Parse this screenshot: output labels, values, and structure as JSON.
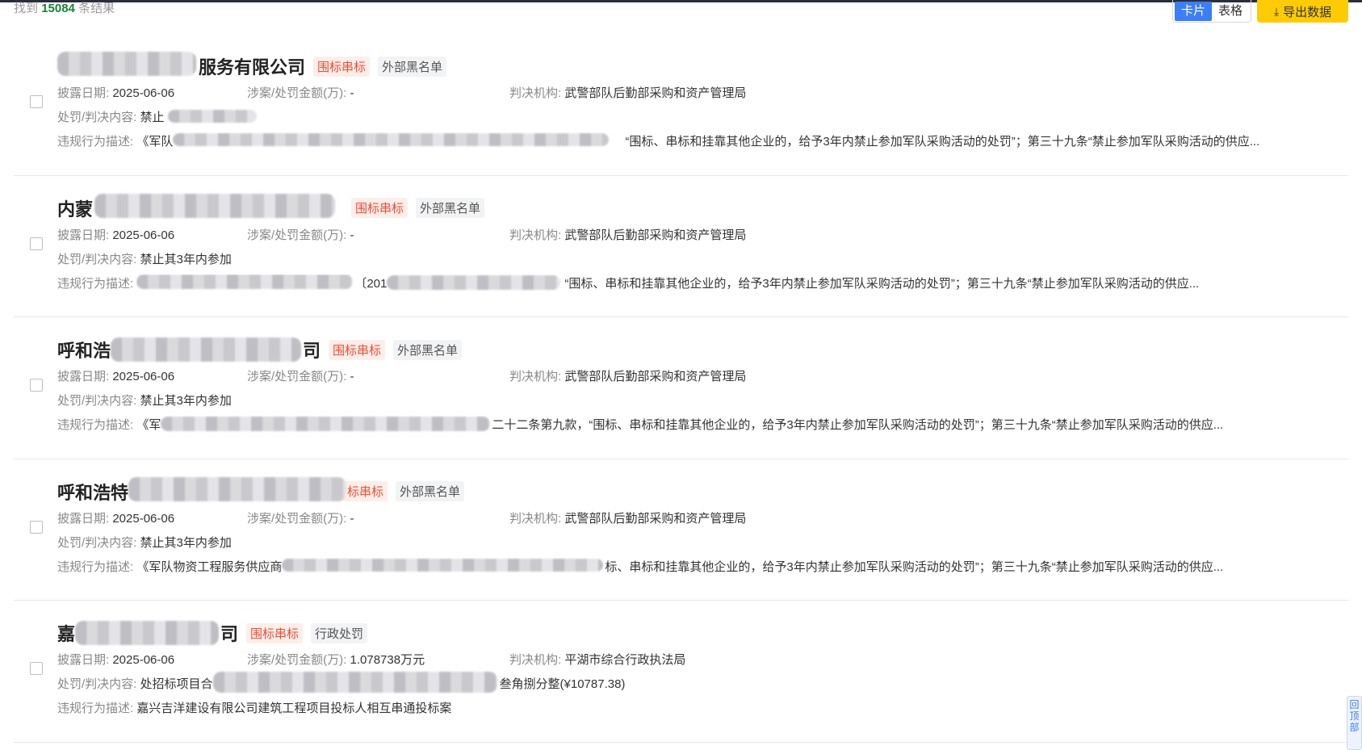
{
  "header": {
    "summary_prefix": "找到",
    "result_count": "15084",
    "summary_suffix": "条结果",
    "view_card": "卡片",
    "view_table": "表格",
    "export_label": "导出数据",
    "export_icon": "download-icon"
  },
  "labels": {
    "date": "披露日期:",
    "amount": "涉案/处罚金额(万):",
    "authority": "判决机构:",
    "penalty": "处罚/判决内容:",
    "violation": "违规行为描述:"
  },
  "records": [
    {
      "title": "服务有限公司",
      "tag1": "围标串标",
      "tag2": "外部黑名单",
      "date": "2025-06-06",
      "amount": "-",
      "authority": "武警部队后勤部采购和资产管理局",
      "penalty": "禁止",
      "violation": "《军队",
      "violation_tail": "“围标、串标和挂靠其他企业的，给予3年内禁止参加军队采购活动的处罚”；第三十九条“禁止参加军队采购活动的供应..."
    },
    {
      "title": "内蒙",
      "tag1": "围标串标",
      "tag2": "外部黑名单",
      "date": "2025-06-06",
      "amount": "-",
      "authority": "武警部队后勤部采购和资产管理局",
      "penalty": "禁止其3年内参加",
      "violation": "〔201",
      "violation_tail": "“围标、串标和挂靠其他企业的，给予3年内禁止参加军队采购活动的处罚”；第三十九条“禁止参加军队采购活动的供应..."
    },
    {
      "title": "呼和浩",
      "title_end": "司",
      "tag1": "围标串标",
      "tag2": "外部黑名单",
      "date": "2025-06-06",
      "amount": "-",
      "authority": "武警部队后勤部采购和资产管理局",
      "penalty": "禁止其3年内参加",
      "violation": "《军",
      "violation_tail": "二十二条第九款，“围标、串标和挂靠其他企业的，给予3年内禁止参加军队采购活动的处罚”；第三十九条“禁止参加军队采购活动的供应..."
    },
    {
      "title": "呼和浩特",
      "tag1": "标串标",
      "tag2": "外部黑名单",
      "date": "2025-06-06",
      "amount": "-",
      "authority": "武警部队后勤部采购和资产管理局",
      "penalty": "禁止其3年内参加",
      "violation": "《军队物资工程服务供应商",
      "violation_tail": "标、串标和挂靠其他企业的，给予3年内禁止参加军队采购活动的处罚”；第三十九条“禁止参加军队采购活动的供应..."
    },
    {
      "title": "嘉",
      "title_end": "司",
      "tag1": "围标串标",
      "tag2": "行政处罚",
      "date": "2025-06-06",
      "amount": "1.078738万元",
      "authority": "平湖市综合行政执法局",
      "penalty": "处招标项目合",
      "penalty_tail": "叁角捌分整(¥10787.38)",
      "violation": "嘉兴吉洋建设有限公司建筑工程项目投标人相互串通投标案",
      "violation_tail": ""
    }
  ],
  "back_to_top": "回顶部"
}
